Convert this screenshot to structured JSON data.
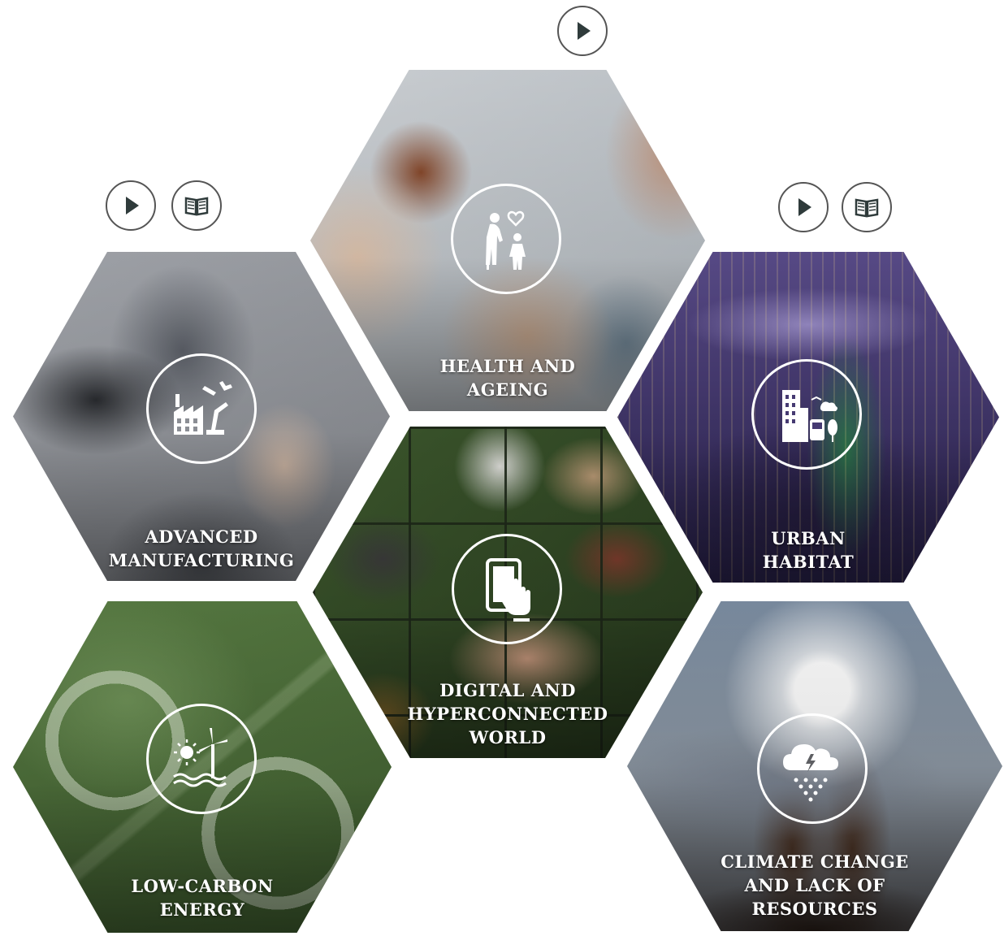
{
  "hexagons": {
    "health": {
      "title": "HEALTH AND\nAGEING",
      "icon": "elderly-child-heart-icon"
    },
    "manufacturing": {
      "title": "ADVANCED\nMANUFACTURING",
      "icon": "factory-robot-arm-icon"
    },
    "urban": {
      "title": "URBAN\nHABITAT",
      "icon": "city-buildings-bus-icon"
    },
    "digital": {
      "title": "DIGITAL AND\nHYPERCONNECTED\nWORLD",
      "icon": "tablet-touch-icon"
    },
    "energy": {
      "title": "LOW-CARBON\nENERGY",
      "icon": "sun-wind-turbine-icon"
    },
    "climate": {
      "title": "CLIMATE CHANGE\nAND LACK OF\nRESOURCES",
      "icon": "cloud-rain-lightning-icon"
    }
  },
  "controls": {
    "play_icon": "play-icon",
    "book_icon": "book-icon"
  },
  "colors": {
    "button_border": "#555555",
    "icon_fill": "#2f3b3b"
  }
}
